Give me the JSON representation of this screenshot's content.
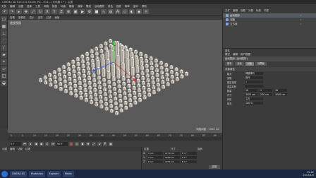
{
  "window": {
    "title": "CINEMA 4D R14.014 Studio (RC - R14) - [未标题 1 *] - 主要"
  },
  "menu": {
    "items": [
      "文件",
      "编辑",
      "创建",
      "选择",
      "工具",
      "网格",
      "捕捉",
      "动画",
      "模拟",
      "渲染",
      "雕刻",
      "运动跟踪",
      "角色",
      "插件",
      "脚本",
      "窗口",
      "帮助"
    ]
  },
  "viewport_menu": {
    "items": [
      "查看",
      "摄像机",
      "显示",
      "选项",
      "过滤",
      "面板"
    ]
  },
  "viewport": {
    "label": "透视视图",
    "grid_spacing": "网格间距 : 1000 cm",
    "background": "#5a5a5a",
    "box_color": "#ece7df",
    "box_shadow": "#9a948c"
  },
  "timeline": {
    "ticks": [
      "0",
      "5",
      "10",
      "15",
      "20",
      "25",
      "30",
      "35",
      "40",
      "45",
      "50",
      "55",
      "60",
      "65",
      "70",
      "75",
      "80",
      "85",
      "90"
    ],
    "end": "0 F"
  },
  "transport": {
    "current_frame": "0 F",
    "end_frame": "90 F"
  },
  "materials": {
    "tabs": [
      "创建",
      "编辑",
      "功能",
      "纹理"
    ]
  },
  "coordinates": {
    "headers": [
      "位置",
      "尺寸",
      "旋转"
    ],
    "rows": [
      {
        "axis": "X",
        "pos": "0 cm",
        "size": "4772 cm",
        "rot": "H 0 °"
      },
      {
        "axis": "Y",
        "pos": "0 cm",
        "size": "1600 cm",
        "rot": "P 0 °"
      },
      {
        "axis": "Z",
        "pos": "0 cm",
        "size": "4772 cm",
        "rot": "B 0 °"
      }
    ],
    "mode": "对象 (相对)",
    "size_mode": "绝对尺寸",
    "apply": "应用"
  },
  "object_manager": {
    "tabs": [
      "文件",
      "编辑",
      "查看",
      "对象",
      "标签",
      "书签"
    ],
    "objects": [
      {
        "name": "运动图形",
        "selected": true
      },
      {
        "name": "克隆",
        "selected": false
      },
      {
        "name": "立方体",
        "selected": false
      }
    ]
  },
  "attributes": {
    "header": "属性",
    "modes": [
      "模式",
      "编辑",
      "用户数据"
    ],
    "title": "运动图形 [运动图形]",
    "tabs": [
      "基本",
      "坐标",
      "对象",
      "效果器"
    ],
    "section": "对象属性",
    "rows": [
      {
        "key": "模式",
        "value": "网格排列"
      },
      {
        "key": "克隆",
        "value": "迭代"
      },
      {
        "key": "固定克隆",
        "value": "✓"
      },
      {
        "key": "渲染实例",
        "value": ""
      },
      {
        "key": "数量",
        "value": "16",
        "value2": "1",
        "value3": "16"
      },
      {
        "key": "尺寸",
        "value": "3000 cm",
        "value2": "200 cm",
        "value3": "3000 cm"
      },
      {
        "key": "外形",
        "value": "立方"
      },
      {
        "key": "填充",
        "value": "100 %"
      }
    ]
  },
  "taskbar": {
    "windows": [
      "CINEMA 4D",
      "Photoshop",
      "Explorer",
      "Media"
    ],
    "time": "15:42",
    "date": "2013/4/3"
  }
}
